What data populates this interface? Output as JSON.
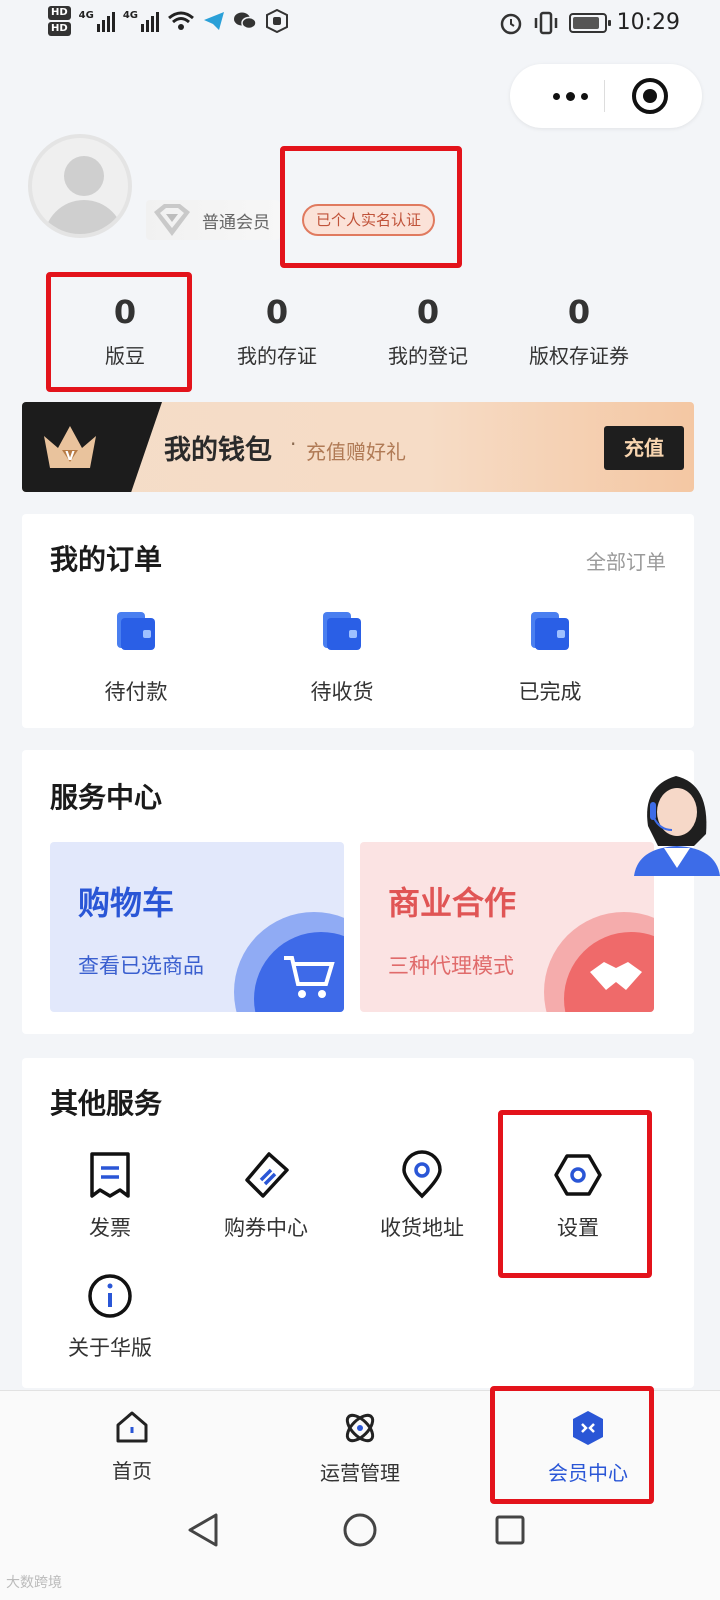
{
  "status_bar": {
    "time": "10:29",
    "signal_labels": [
      "4G",
      "4G"
    ],
    "hd_labels": [
      "HD",
      "HD"
    ]
  },
  "profile": {
    "member_level": "普通会员",
    "verified_badge": "已个人实名认证"
  },
  "stats": [
    {
      "value": "0",
      "label": "版豆"
    },
    {
      "value": "0",
      "label": "我的存证"
    },
    {
      "value": "0",
      "label": "我的登记"
    },
    {
      "value": "0",
      "label": "版权存证券"
    }
  ],
  "wallet": {
    "title": "我的钱包",
    "dot": "·",
    "subtitle": "充值赠好礼",
    "button": "充值"
  },
  "orders": {
    "title": "我的订单",
    "all_link": "全部订单",
    "items": [
      {
        "label": "待付款"
      },
      {
        "label": "待收货"
      },
      {
        "label": "已完成"
      }
    ]
  },
  "service_center": {
    "title": "服务中心",
    "cards": [
      {
        "title": "购物车",
        "subtitle": "查看已选商品"
      },
      {
        "title": "商业合作",
        "subtitle": "三种代理模式"
      }
    ]
  },
  "other_services": {
    "title": "其他服务",
    "items": [
      {
        "label": "发票",
        "icon": "invoice-icon"
      },
      {
        "label": "购券中心",
        "icon": "ticket-icon"
      },
      {
        "label": "收货地址",
        "icon": "location-icon"
      },
      {
        "label": "设置",
        "icon": "settings-icon"
      },
      {
        "label": "关于华版",
        "icon": "info-icon"
      }
    ]
  },
  "tabbar": {
    "items": [
      {
        "label": "首页",
        "icon": "home-icon"
      },
      {
        "label": "运营管理",
        "icon": "operations-icon"
      },
      {
        "label": "会员中心",
        "icon": "member-center-icon",
        "active": true
      }
    ]
  },
  "watermark": "大数跨境",
  "colors": {
    "accent_blue": "#2a56d6",
    "highlight_red": "#e3131b",
    "partner_red": "#e05555"
  }
}
